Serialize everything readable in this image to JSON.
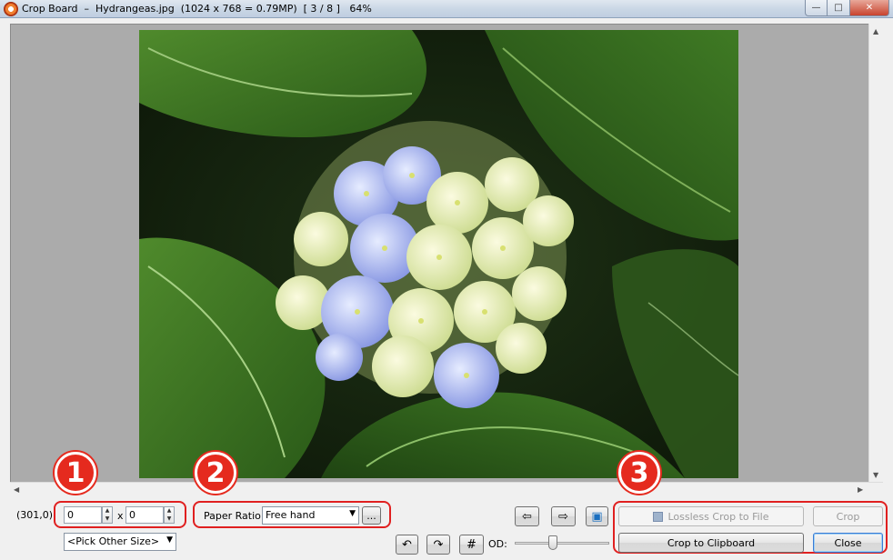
{
  "window": {
    "title": "Crop Board  –  Hydrangeas.jpg  (1024 x 768 = 0.79MP)  [ 3 / 8 ]   64%",
    "minimize_icon": "minimize-icon",
    "maximize_icon": "maximize-icon",
    "close_icon": "close-icon"
  },
  "image": {
    "alt": "Hydrangeas photo"
  },
  "status": {
    "coordinates": "(301,0)"
  },
  "size_group": {
    "width_value": "0",
    "separator": "x",
    "height_value": "0",
    "pick_size_label": "<Pick Other Size>",
    "badge": "1"
  },
  "ratio_group": {
    "label": "Paper Ratio:",
    "selected": "Free hand",
    "more_button": "...",
    "badge": "2"
  },
  "nav": {
    "prev_icon": "arrow-left-icon",
    "next_icon": "arrow-right-icon",
    "fit_icon": "fit-screen-icon",
    "rotate_left_icon": "rotate-left-icon",
    "rotate_right_icon": "rotate-right-icon",
    "grid_icon": "grid-icon",
    "od_label": "OD:",
    "od_level": 0.4
  },
  "action_group": {
    "lossless_crop": "Lossless Crop to File",
    "crop": "Crop",
    "crop_clipboard": "Crop to Clipboard",
    "close": "Close",
    "badge": "3"
  }
}
